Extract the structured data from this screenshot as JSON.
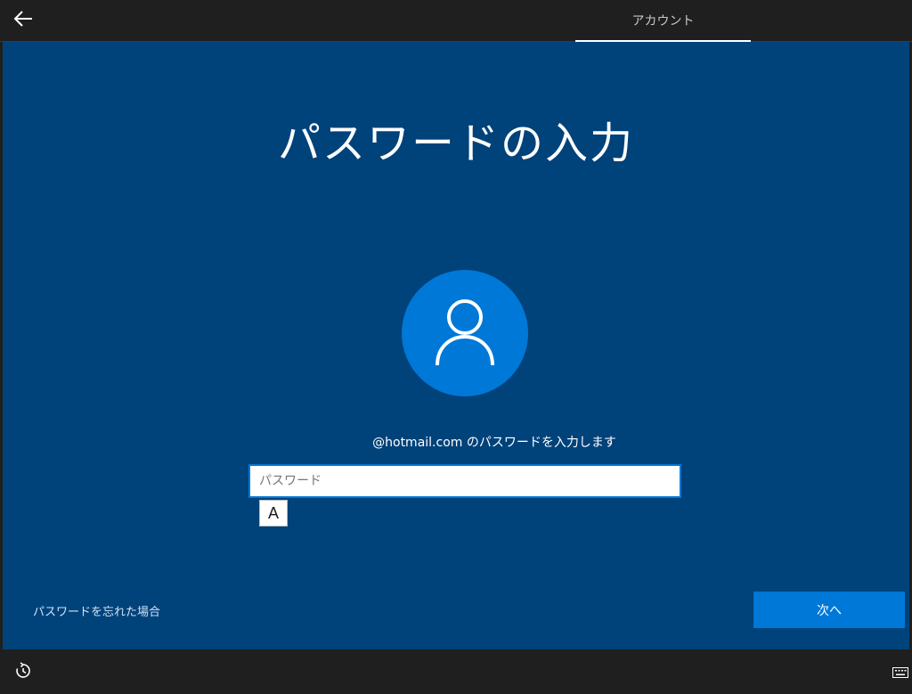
{
  "header": {
    "back_icon": "back-arrow-icon",
    "step_label": "アカウント"
  },
  "main": {
    "title": "パスワードの入力",
    "avatar_icon": "user-icon",
    "prompt": "@hotmail.com のパスワードを入力します",
    "password_input": {
      "placeholder": "パスワード",
      "value": ""
    },
    "ime_mode": "A",
    "forgot_link": "パスワードを忘れた場合",
    "next_button": "次へ"
  },
  "footer": {
    "ease_of_access_icon": "ease-of-access-icon",
    "keyboard_icon": "keyboard-icon"
  },
  "colors": {
    "panel_bg": "#00427a",
    "accent": "#0078d7",
    "chrome_bg": "#1f1f1f"
  }
}
